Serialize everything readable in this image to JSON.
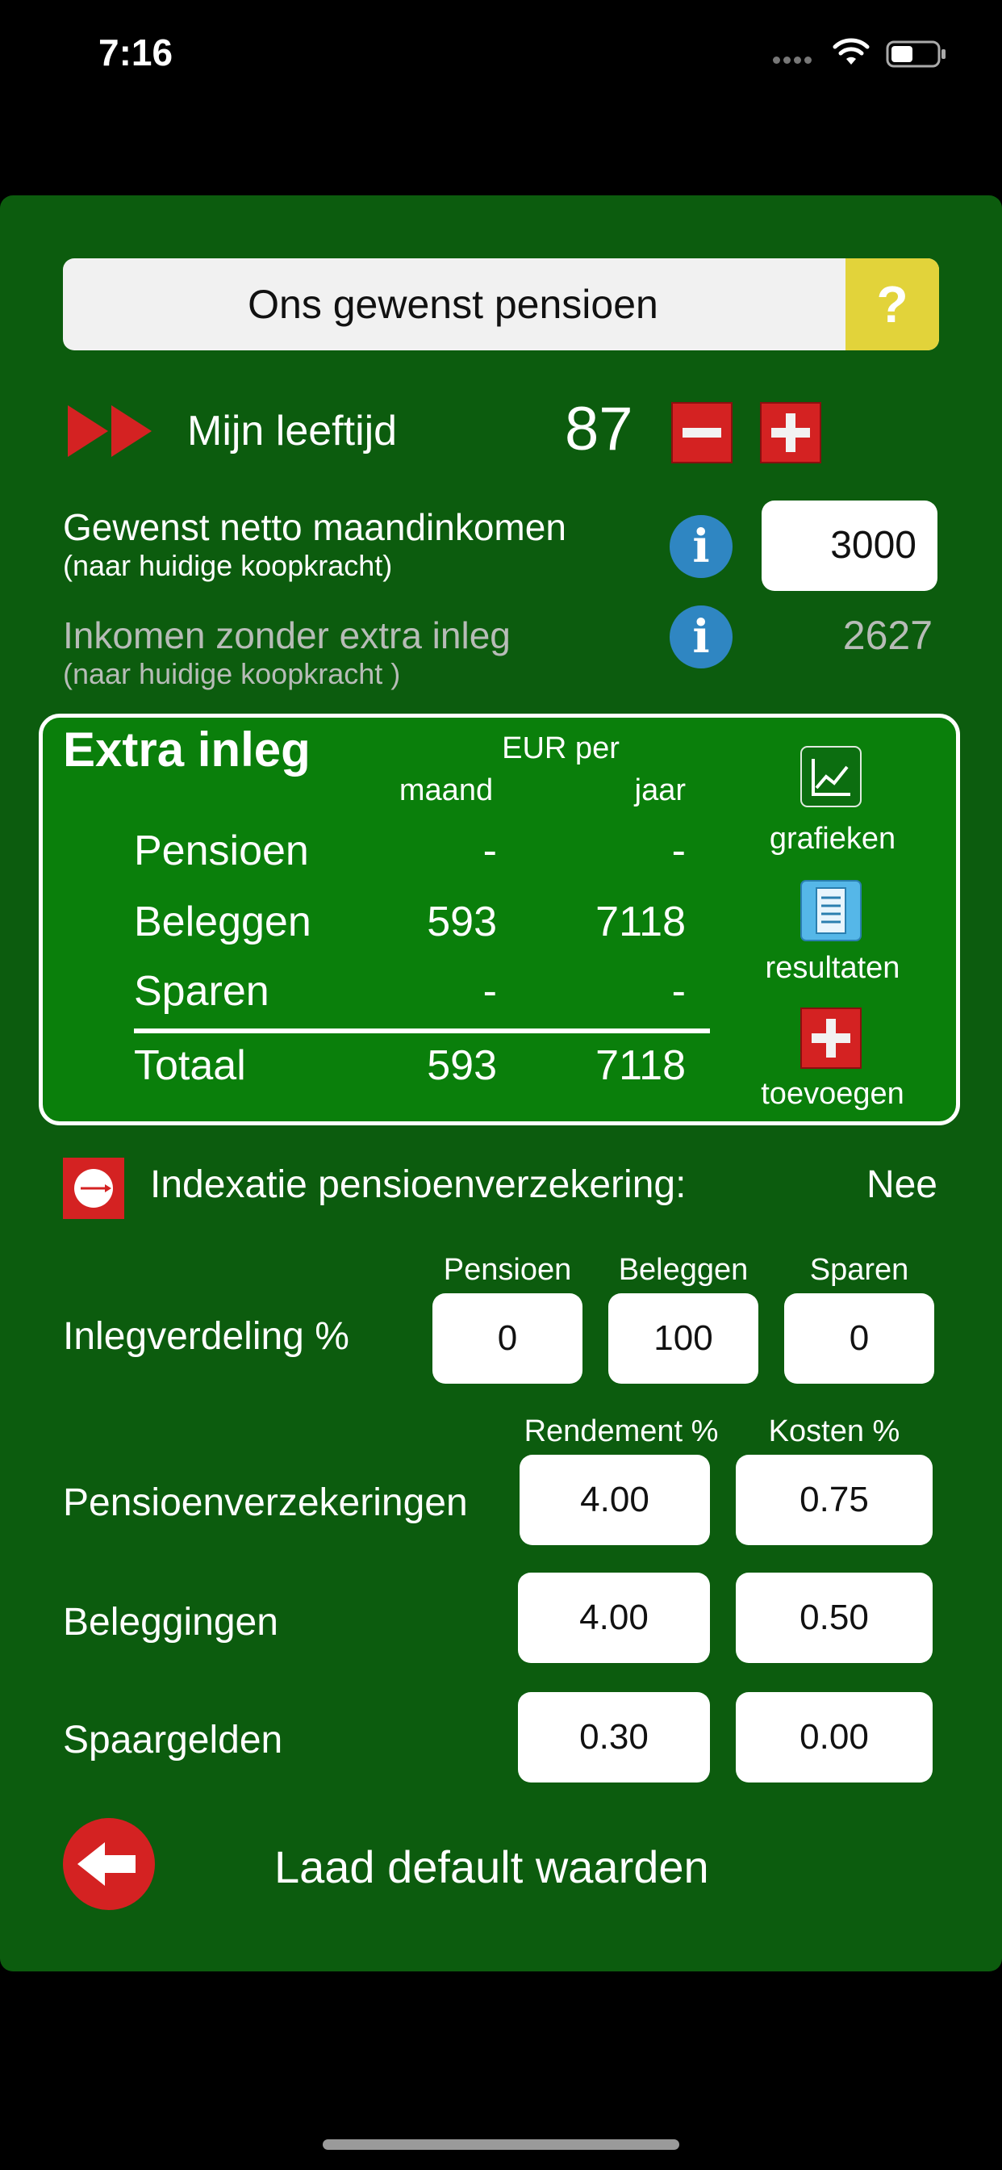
{
  "status": {
    "time": "7:16"
  },
  "header": {
    "title": "Ons gewenst pensioen",
    "help": "?"
  },
  "age": {
    "label": "Mijn leeftijd",
    "value": "87"
  },
  "desired": {
    "label": "Gewenst netto maandinkomen",
    "sublabel": "(naar huidige koopkracht)",
    "value": "3000"
  },
  "without": {
    "label": "Inkomen zonder extra inleg",
    "sublabel": "(naar huidige koopkracht )",
    "value": "2627"
  },
  "extra": {
    "title": "Extra inleg",
    "currency_header": "EUR per",
    "col_month": "maand",
    "col_year": "jaar",
    "rows": [
      {
        "label": "Pensioen",
        "month": "-",
        "year": "-"
      },
      {
        "label": "Beleggen",
        "month": "593",
        "year": "7118"
      },
      {
        "label": "Sparen",
        "month": "-",
        "year": "-"
      }
    ],
    "total": {
      "label": "Totaal",
      "month": "593",
      "year": "7118"
    },
    "side": {
      "charts": "grafieken",
      "results": "resultaten",
      "add": "toevoegen"
    }
  },
  "indexation": {
    "label": "Indexatie pensioenverzekering:",
    "value": "Nee"
  },
  "distribution": {
    "label": "Inlegverdeling %",
    "headers": [
      "Pensioen",
      "Beleggen",
      "Sparen"
    ],
    "values": [
      "0",
      "100",
      "0"
    ]
  },
  "returns": {
    "headers": {
      "return": "Rendement %",
      "costs": "Kosten %"
    },
    "rows": [
      {
        "label": "Pensioenverzekeringen",
        "return": "4.00",
        "costs": "0.75"
      },
      {
        "label": "Beleggingen",
        "return": "4.00",
        "costs": "0.50"
      },
      {
        "label": "Spaargelden",
        "return": "0.30",
        "costs": "0.00"
      }
    ]
  },
  "reset": {
    "label": "Laad default waarden"
  },
  "colors": {
    "background": "#000000",
    "panel": "#0c5c0e",
    "inleg_box": "#0a7f0b",
    "button_red": "#d42222",
    "help_yellow": "#e2d33a",
    "info_blue": "#2f86c2"
  }
}
